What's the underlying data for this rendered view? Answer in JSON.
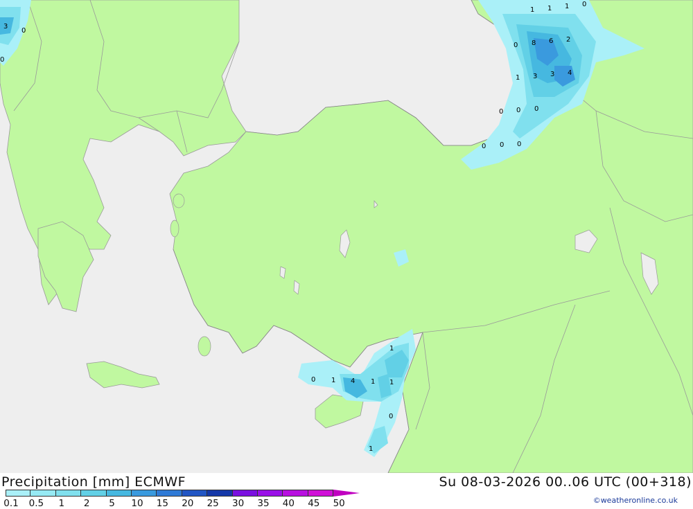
{
  "header": {
    "title": "Precipitation [mm] ECMWF",
    "datetime": "Su 08-03-2026 00..06 UTC (00+318)",
    "credit": "©weatheronline.co.uk"
  },
  "legend": {
    "labels": [
      "0.1",
      "0.5",
      "1",
      "2",
      "5",
      "10",
      "15",
      "20",
      "25",
      "30",
      "35",
      "40",
      "45",
      "50"
    ],
    "colors": [
      "#aaf0f8",
      "#96eaf4",
      "#80e0ee",
      "#62d0e6",
      "#46b8e0",
      "#3a9ade",
      "#2f7ad6",
      "#2256c4",
      "#1438a8",
      "#7a10e0",
      "#9a10e8",
      "#b810e0",
      "#d010d8",
      "#c000c0"
    ]
  },
  "map": {
    "colors": {
      "sea": "#eeeeee",
      "land": "#c0f8a0",
      "border": "#999999"
    },
    "values": [
      "3",
      "0",
      "0",
      "1",
      "1",
      "1",
      "0",
      "0",
      "8",
      "6",
      "2",
      "1",
      "3",
      "3",
      "4",
      "0",
      "0",
      "0",
      "0",
      "0",
      "0",
      "1",
      "0",
      "1",
      "4",
      "1",
      "1",
      "0",
      "1"
    ]
  }
}
